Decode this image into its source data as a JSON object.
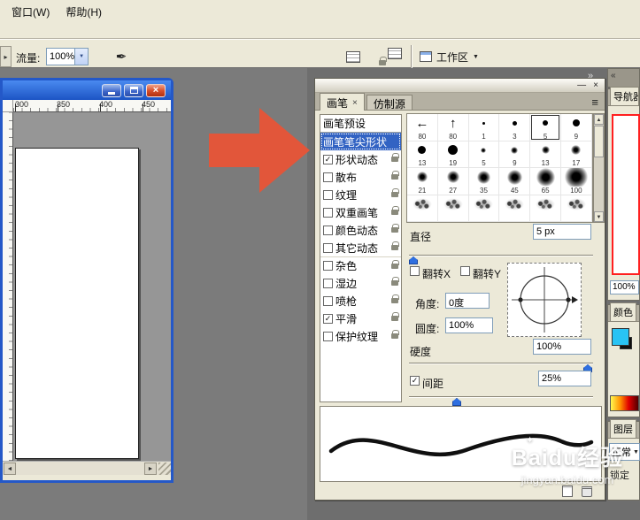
{
  "icons": {
    "close": "×",
    "minimize": "—",
    "menu": "≡",
    "dropdown": "▼",
    "scroll_up": "▲",
    "scroll_down": "▼",
    "scroll_left": "◄",
    "scroll_right": "►",
    "collapse_right": "»",
    "collapse_left": "«",
    "check": "✓",
    "caret": "▸",
    "arrow_brush_left": "←",
    "arrow_brush_up": "↑",
    "airbrush_pen": "✒",
    "sparkle": "✦"
  },
  "menu_bar": {
    "items": [
      {
        "label": "窗口(W)"
      },
      {
        "label": "帮助(H)"
      }
    ]
  },
  "options_bar": {
    "flow": {
      "label": "流量:",
      "value": "100%"
    },
    "workspace": {
      "label": "工作区"
    }
  },
  "document_window": {
    "ruler_marks": [
      "300",
      "350",
      "400",
      "450"
    ]
  },
  "brush_panel": {
    "tabs": [
      {
        "label": "画笔",
        "active": true
      },
      {
        "label": "仿制源",
        "active": false
      }
    ],
    "presets_label": "画笔预设",
    "tip_shape_label": "画笔笔尖形状",
    "options": [
      {
        "label": "形状动态",
        "checked": true
      },
      {
        "label": "散布",
        "checked": false
      },
      {
        "label": "纹理",
        "checked": false
      },
      {
        "label": "双重画笔",
        "checked": false
      },
      {
        "label": "颜色动态",
        "checked": false
      },
      {
        "label": "其它动态",
        "checked": false
      },
      {
        "label": "杂色",
        "checked": false
      },
      {
        "label": "湿边",
        "checked": false
      },
      {
        "label": "喷枪",
        "checked": false
      },
      {
        "label": "平滑",
        "checked": true
      },
      {
        "label": "保护纹理",
        "checked": false
      }
    ],
    "grid": {
      "cells": [
        {
          "type": "arrow-left",
          "label": "80"
        },
        {
          "type": "arrow-up",
          "label": "80"
        },
        {
          "type": "dot",
          "size": 1,
          "label": "1"
        },
        {
          "type": "dot",
          "size": 3,
          "label": "3"
        },
        {
          "type": "dot",
          "size": 5,
          "label": "5",
          "selected": true
        },
        {
          "type": "dot",
          "size": 9,
          "label": "9"
        },
        {
          "type": "dot",
          "size": 13,
          "label": "13"
        },
        {
          "type": "dot",
          "size": 19,
          "label": "19"
        },
        {
          "type": "soft",
          "size": 5,
          "label": "5"
        },
        {
          "type": "soft",
          "size": 9,
          "label": "9"
        },
        {
          "type": "soft",
          "size": 13,
          "label": "13"
        },
        {
          "type": "soft",
          "size": 17,
          "label": "17"
        },
        {
          "type": "soft",
          "size": 21,
          "label": "21"
        },
        {
          "type": "soft",
          "size": 27,
          "label": "27"
        },
        {
          "type": "soft",
          "size": 35,
          "label": "35"
        },
        {
          "type": "soft",
          "size": 45,
          "label": "45"
        },
        {
          "type": "soft",
          "size": 65,
          "label": "65"
        },
        {
          "type": "soft",
          "size": 100,
          "label": "100"
        },
        {
          "type": "texture",
          "label": ""
        },
        {
          "type": "texture",
          "label": ""
        },
        {
          "type": "texture",
          "label": ""
        },
        {
          "type": "texture",
          "label": ""
        },
        {
          "type": "texture",
          "label": ""
        },
        {
          "type": "texture",
          "label": ""
        }
      ]
    },
    "diameter": {
      "label": "直径",
      "value": "5 px",
      "percent": 0
    },
    "flip_x_label": "翻转X",
    "flip_y_label": "翻转Y",
    "angle": {
      "label": "角度:",
      "value": "0度"
    },
    "roundness": {
      "label": "圆度:",
      "value": "100%"
    },
    "hardness": {
      "label": "硬度",
      "value": "100%",
      "percent": 100
    },
    "spacing": {
      "label": "间距",
      "value": "25%",
      "checked": true,
      "percent": 25
    }
  },
  "right_dock": {
    "navigator": {
      "tab": "导航器",
      "zoom": "100%"
    },
    "color": {
      "tab": "颜色",
      "swatch": "#29c3f4"
    },
    "layers": {
      "tab": "图层",
      "blend_mode": "正常",
      "lock_label": "锁定"
    }
  },
  "watermark": {
    "title": "Baidu经验",
    "url": "jingyan.baidu.com"
  },
  "colors": {
    "arrow": "#e2563a",
    "selection": "#3263c3",
    "slider_thumb": "#2f6fe0",
    "navigator_frame": "#ff1f1f"
  }
}
